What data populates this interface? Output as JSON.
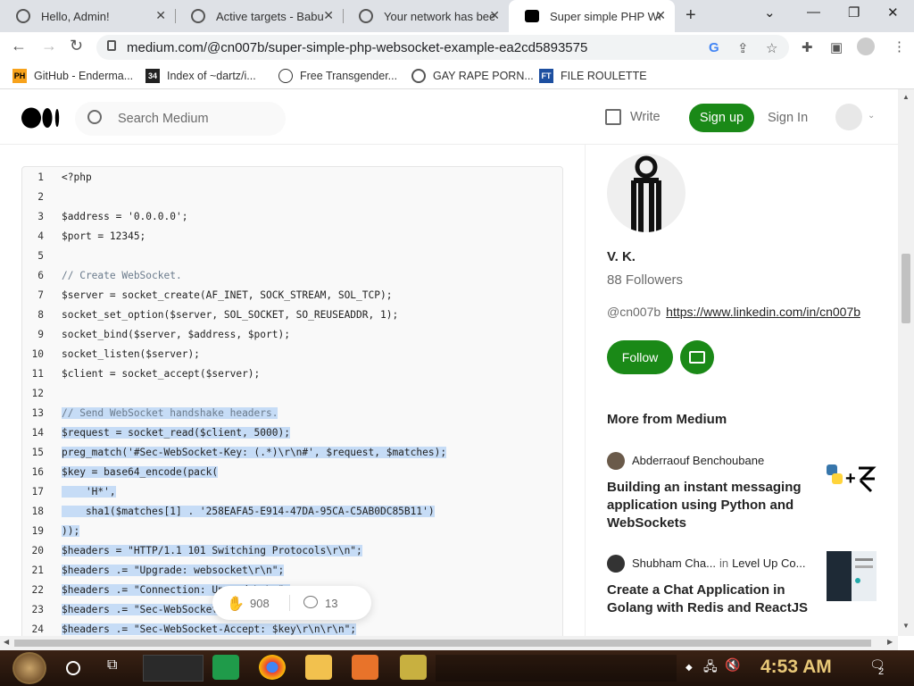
{
  "browser": {
    "tabs": [
      {
        "title": "Hello, Admin!"
      },
      {
        "title": "Active targets - Babu"
      },
      {
        "title": "Your network has bee"
      },
      {
        "title": "Super simple PHP We"
      }
    ],
    "url": "medium.com/@cn007b/super-simple-php-websocket-example-ea2cd5893575",
    "bookmarks": [
      {
        "icon_text": "PH",
        "label": "GitHub - Enderma..."
      },
      {
        "icon_text": "34",
        "label": "Index of ~dartz/i..."
      },
      {
        "icon_text": "",
        "label": "Free Transgender..."
      },
      {
        "icon_text": "",
        "label": "GAY RAPE PORN..."
      },
      {
        "icon_text": "",
        "label": "FILE ROULETTE"
      }
    ]
  },
  "header": {
    "search_placeholder": "Search Medium",
    "write": "Write",
    "signup": "Sign up",
    "signin": "Sign In"
  },
  "code": {
    "lines": [
      {
        "n": "1",
        "t": "<?php"
      },
      {
        "n": "2",
        "t": ""
      },
      {
        "n": "3",
        "t": "$address = '0.0.0.0';"
      },
      {
        "n": "4",
        "t": "$port = 12345;"
      },
      {
        "n": "5",
        "t": ""
      },
      {
        "n": "6",
        "t": "// Create WebSocket."
      },
      {
        "n": "7",
        "t": "$server = socket_create(AF_INET, SOCK_STREAM, SOL_TCP);"
      },
      {
        "n": "8",
        "t": "socket_set_option($server, SOL_SOCKET, SO_REUSEADDR, 1);"
      },
      {
        "n": "9",
        "t": "socket_bind($server, $address, $port);"
      },
      {
        "n": "10",
        "t": "socket_listen($server);"
      },
      {
        "n": "11",
        "t": "$client = socket_accept($server);"
      },
      {
        "n": "12",
        "t": ""
      },
      {
        "n": "13",
        "t": "// Send WebSocket handshake headers."
      },
      {
        "n": "14",
        "t": "$request = socket_read($client, 5000);"
      },
      {
        "n": "15",
        "t": "preg_match('#Sec-WebSocket-Key: (.*)\\r\\n#', $request, $matches);"
      },
      {
        "n": "16",
        "t": "$key = base64_encode(pack("
      },
      {
        "n": "17",
        "t": "    'H*',"
      },
      {
        "n": "18",
        "t": "    sha1($matches[1] . '258EAFA5-E914-47DA-95CA-C5AB0DC85B11')"
      },
      {
        "n": "19",
        "t": "));"
      },
      {
        "n": "20",
        "t": "$headers = \"HTTP/1.1 101 Switching Protocols\\r\\n\";"
      },
      {
        "n": "21",
        "t": "$headers .= \"Upgrade: websocket\\r\\n\";"
      },
      {
        "n": "22",
        "t": "$headers .= \"Connection: Upgrade\\r\\n\";"
      },
      {
        "n": "23",
        "t": "$headers .= \"Sec-WebSocket-Version: 13\\r\\n\";"
      },
      {
        "n": "24",
        "t": "$headers .= \"Sec-WebSocket-Accept: $key\\r\\n\\r\\n\";"
      }
    ]
  },
  "engagement": {
    "claps": "908",
    "responses": "13"
  },
  "author": {
    "name": "V. K.",
    "followers": "88 Followers",
    "handle": "@cn007b",
    "link": "https://www.linkedin.com/in/cn007b",
    "follow": "Follow"
  },
  "more_from": {
    "heading": "More from Medium",
    "articles": [
      {
        "author": "Abderraouf Benchoubane",
        "publication": "",
        "in": "",
        "title": "Building an instant messaging application using Python and WebSockets"
      },
      {
        "author": "Shubham Cha...",
        "in": "in",
        "publication": "Level Up Co...",
        "title": "Create a Chat Application in Golang with Redis and ReactJS"
      }
    ]
  },
  "taskbar": {
    "clock": "4:53 AM",
    "notif_count": "2"
  },
  "colors": {
    "accent": "#1a8917",
    "selection": "#c6dcf6"
  }
}
